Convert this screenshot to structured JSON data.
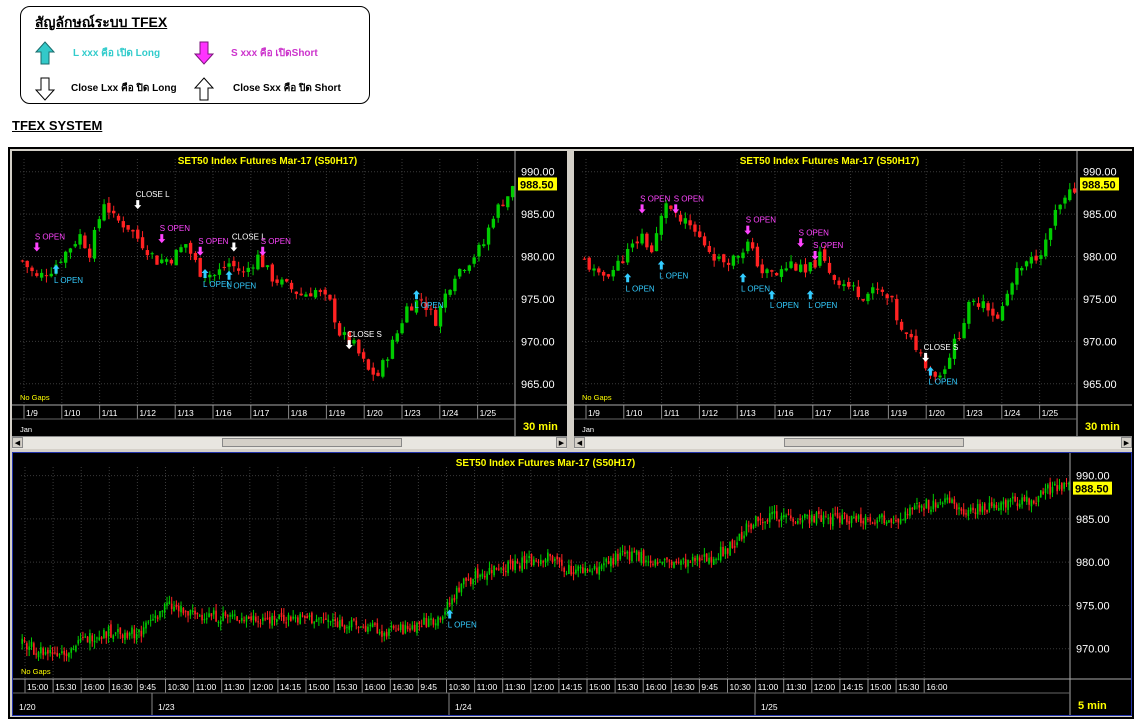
{
  "legend": {
    "title": "สัญลักษณ์ระบบ TFEX",
    "long_open": "L xxx คือ เปิด Long",
    "short_open": "S xxx คือ เปิดShort",
    "long_close": "Close Lxx คือ ปิด Long",
    "short_close": "Close Sxx คือ ปิด Short"
  },
  "system_title": "TFEX SYSTEM",
  "colors": {
    "up": "#00cc00",
    "down": "#ff2222",
    "title": "#ffff00",
    "long_signal": "#33ccff",
    "short_signal": "#ff44ff",
    "close_signal": "#ffffff",
    "grid": "#3a3a3a",
    "background": "#000000"
  },
  "chart_data": [
    {
      "type": "candlestick",
      "title": "SET50  Index  Futures  Mar-17  (S50H17)",
      "timeframe": "30  min",
      "last_price": "988.50",
      "note": "No Gaps",
      "month_label": "Jan",
      "y_ticks": [
        "990.00",
        "985.00",
        "980.00",
        "975.00",
        "970.00",
        "965.00"
      ],
      "ylim": [
        962.5,
        991.5
      ],
      "x_ticks": [
        "1/9",
        "1/10",
        "1/11",
        "1/12",
        "1/13",
        "1/16",
        "1/17",
        "1/18",
        "1/19",
        "1/20",
        "1/23",
        "1/24",
        "1/25"
      ],
      "close_path": [
        [
          0,
          979.5
        ],
        [
          3,
          977.5
        ],
        [
          6,
          978.5
        ],
        [
          9,
          980.5
        ],
        [
          12,
          982.5
        ],
        [
          14,
          980.5
        ],
        [
          17,
          986.5
        ],
        [
          19,
          984.5
        ],
        [
          22,
          983.5
        ],
        [
          25,
          981.5
        ],
        [
          28,
          979.5
        ],
        [
          31,
          979.8
        ],
        [
          34,
          981.5
        ],
        [
          37,
          978.2
        ],
        [
          40,
          977.8
        ],
        [
          43,
          979.2
        ],
        [
          46,
          978.0
        ],
        [
          49,
          980.0
        ],
        [
          52,
          977.5
        ],
        [
          55,
          976.5
        ],
        [
          58,
          975.5
        ],
        [
          61,
          976.0
        ],
        [
          64,
          974.5
        ],
        [
          66,
          971.0
        ],
        [
          69,
          969.5
        ],
        [
          72,
          966.5
        ],
        [
          74,
          966.0
        ],
        [
          76,
          968.5
        ],
        [
          78,
          971.0
        ],
        [
          80,
          974.0
        ],
        [
          83,
          975.0
        ],
        [
          86,
          972.5
        ],
        [
          88,
          975.5
        ],
        [
          90,
          978.0
        ],
        [
          93,
          979.5
        ],
        [
          96,
          981.5
        ],
        [
          98,
          985.0
        ],
        [
          100,
          986.5
        ],
        [
          102,
          988.0
        ]
      ],
      "signals": [
        {
          "label": "S  OPEN",
          "kind": "short",
          "bar": 3,
          "price": 980.0
        },
        {
          "label": "L  OPEN",
          "kind": "long",
          "bar": 7,
          "price": 979.5
        },
        {
          "label": "CLOSE  L",
          "kind": "close",
          "bar": 24,
          "price": 985.0
        },
        {
          "label": "S  OPEN",
          "kind": "short",
          "bar": 29,
          "price": 981.0
        },
        {
          "label": "S  OPEN",
          "kind": "short",
          "bar": 37,
          "price": 979.5
        },
        {
          "label": "L  OPEN",
          "kind": "long",
          "bar": 38,
          "price": 979.0
        },
        {
          "label": "CLOSE  L",
          "kind": "close",
          "bar": 44,
          "price": 980.0
        },
        {
          "label": "L  OPEN",
          "kind": "long",
          "bar": 43,
          "price": 978.8
        },
        {
          "label": "S  OPEN",
          "kind": "short",
          "bar": 50,
          "price": 979.5
        },
        {
          "label": "CLOSE  S",
          "kind": "close",
          "bar": 68,
          "price": 968.5
        },
        {
          "label": "L  OPEN",
          "kind": "long",
          "bar": 82,
          "price": 976.5
        }
      ]
    },
    {
      "type": "candlestick",
      "title": "SET50  Index  Futures  Mar-17  (S50H17)",
      "timeframe": "30  min",
      "last_price": "988.50",
      "note": "No Gaps",
      "month_label": "Jan",
      "y_ticks": [
        "990.00",
        "985.00",
        "980.00",
        "975.00",
        "970.00",
        "965.00"
      ],
      "ylim": [
        962.5,
        991.5
      ],
      "x_ticks": [
        "1/9",
        "1/10",
        "1/11",
        "1/12",
        "1/13",
        "1/16",
        "1/17",
        "1/18",
        "1/19",
        "1/20",
        "1/23",
        "1/24",
        "1/25"
      ],
      "close_path": [
        [
          0,
          979.5
        ],
        [
          3,
          977.5
        ],
        [
          6,
          978.5
        ],
        [
          9,
          980.5
        ],
        [
          12,
          982.5
        ],
        [
          14,
          980.5
        ],
        [
          17,
          986.5
        ],
        [
          19,
          984.5
        ],
        [
          22,
          983.5
        ],
        [
          25,
          981.5
        ],
        [
          28,
          979.5
        ],
        [
          31,
          979.8
        ],
        [
          34,
          981.5
        ],
        [
          37,
          978.2
        ],
        [
          40,
          977.8
        ],
        [
          43,
          979.2
        ],
        [
          46,
          978.0
        ],
        [
          49,
          980.0
        ],
        [
          52,
          977.5
        ],
        [
          55,
          976.5
        ],
        [
          58,
          975.5
        ],
        [
          61,
          976.0
        ],
        [
          64,
          974.5
        ],
        [
          66,
          971.0
        ],
        [
          69,
          969.5
        ],
        [
          72,
          966.5
        ],
        [
          74,
          966.0
        ],
        [
          76,
          968.5
        ],
        [
          78,
          971.0
        ],
        [
          80,
          974.0
        ],
        [
          83,
          975.0
        ],
        [
          86,
          972.5
        ],
        [
          88,
          975.5
        ],
        [
          90,
          978.0
        ],
        [
          93,
          979.5
        ],
        [
          96,
          981.5
        ],
        [
          98,
          985.0
        ],
        [
          100,
          986.5
        ],
        [
          102,
          988.0
        ]
      ],
      "signals": [
        {
          "label": "S  OPEN",
          "kind": "short",
          "bar": 12,
          "price": 984.5
        },
        {
          "label": "S  OPEN",
          "kind": "short",
          "bar": 19,
          "price": 984.5
        },
        {
          "label": "L  OPEN",
          "kind": "long",
          "bar": 16,
          "price": 980.0
        },
        {
          "label": "L  OPEN",
          "kind": "long",
          "bar": 9,
          "price": 978.5
        },
        {
          "label": "S  OPEN",
          "kind": "short",
          "bar": 34,
          "price": 982.0
        },
        {
          "label": "L  OPEN",
          "kind": "long",
          "bar": 33,
          "price": 978.5
        },
        {
          "label": "L  OPEN",
          "kind": "long",
          "bar": 39,
          "price": 976.5
        },
        {
          "label": "S  OPEN",
          "kind": "short",
          "bar": 45,
          "price": 980.5
        },
        {
          "label": "S  OPEN",
          "kind": "short",
          "bar": 48,
          "price": 979.0
        },
        {
          "label": "L  OPEN",
          "kind": "long",
          "bar": 47,
          "price": 976.5
        },
        {
          "label": "CLOSE  S",
          "kind": "close",
          "bar": 71,
          "price": 967.0
        },
        {
          "label": "L  OPEN",
          "kind": "long",
          "bar": 72,
          "price": 967.5
        }
      ]
    },
    {
      "type": "candlestick",
      "title": "SET50  Index  Futures  Mar-17  (S50H17)",
      "timeframe": "5  min",
      "last_price": "988.50",
      "note": "No Gaps",
      "y_ticks": [
        "990.00",
        "985.00",
        "980.00",
        "975.00",
        "970.00"
      ],
      "ylim": [
        966.5,
        991.0
      ],
      "x_ticks": [
        "15:00",
        "15:30",
        "16:00",
        "16:30",
        "9:45",
        "10:30",
        "11:00",
        "11:30",
        "12:00",
        "14:15",
        "15:00",
        "15:30",
        "16:00",
        "16:30",
        "9:45",
        "10:30",
        "11:00",
        "11:30",
        "12:00",
        "14:15",
        "15:00",
        "15:30",
        "16:00",
        "16:30",
        "9:45",
        "10:30",
        "11:00",
        "11:30",
        "12:00",
        "14:15",
        "15:00",
        "15:30",
        "16:00"
      ],
      "date_labels": [
        "1/20",
        "1/23",
        "1/24",
        "1/25"
      ],
      "close_path": [
        [
          0,
          970.5
        ],
        [
          10,
          969.5
        ],
        [
          20,
          969.8
        ],
        [
          30,
          971.5
        ],
        [
          40,
          972.0
        ],
        [
          50,
          971.8
        ],
        [
          56,
          973.5
        ],
        [
          62,
          975.0
        ],
        [
          70,
          974.0
        ],
        [
          80,
          973.8
        ],
        [
          95,
          973.5
        ],
        [
          110,
          973.6
        ],
        [
          125,
          973.4
        ],
        [
          135,
          973.0
        ],
        [
          145,
          972.5
        ],
        [
          155,
          972.0
        ],
        [
          165,
          972.2
        ],
        [
          170,
          972.8
        ],
        [
          178,
          973.5
        ],
        [
          183,
          975.0
        ],
        [
          188,
          977.5
        ],
        [
          195,
          978.5
        ],
        [
          205,
          979.5
        ],
        [
          215,
          980.0
        ],
        [
          225,
          980.5
        ],
        [
          235,
          979.0
        ],
        [
          245,
          979.2
        ],
        [
          255,
          980.5
        ],
        [
          262,
          981.0
        ],
        [
          270,
          980.0
        ],
        [
          285,
          979.8
        ],
        [
          295,
          980.5
        ],
        [
          305,
          982.0
        ],
        [
          312,
          984.5
        ],
        [
          320,
          985.5
        ],
        [
          330,
          985.2
        ],
        [
          345,
          985.0
        ],
        [
          360,
          985.0
        ],
        [
          375,
          985.2
        ],
        [
          385,
          986.5
        ],
        [
          395,
          987.0
        ],
        [
          405,
          986.0
        ],
        [
          415,
          986.5
        ],
        [
          425,
          987.0
        ],
        [
          435,
          987.5
        ],
        [
          440,
          988.5
        ],
        [
          448,
          988.6
        ]
      ],
      "signals": [
        {
          "label": "L  OPEN",
          "kind": "long",
          "bar": 183,
          "price": 975.0
        }
      ]
    }
  ]
}
